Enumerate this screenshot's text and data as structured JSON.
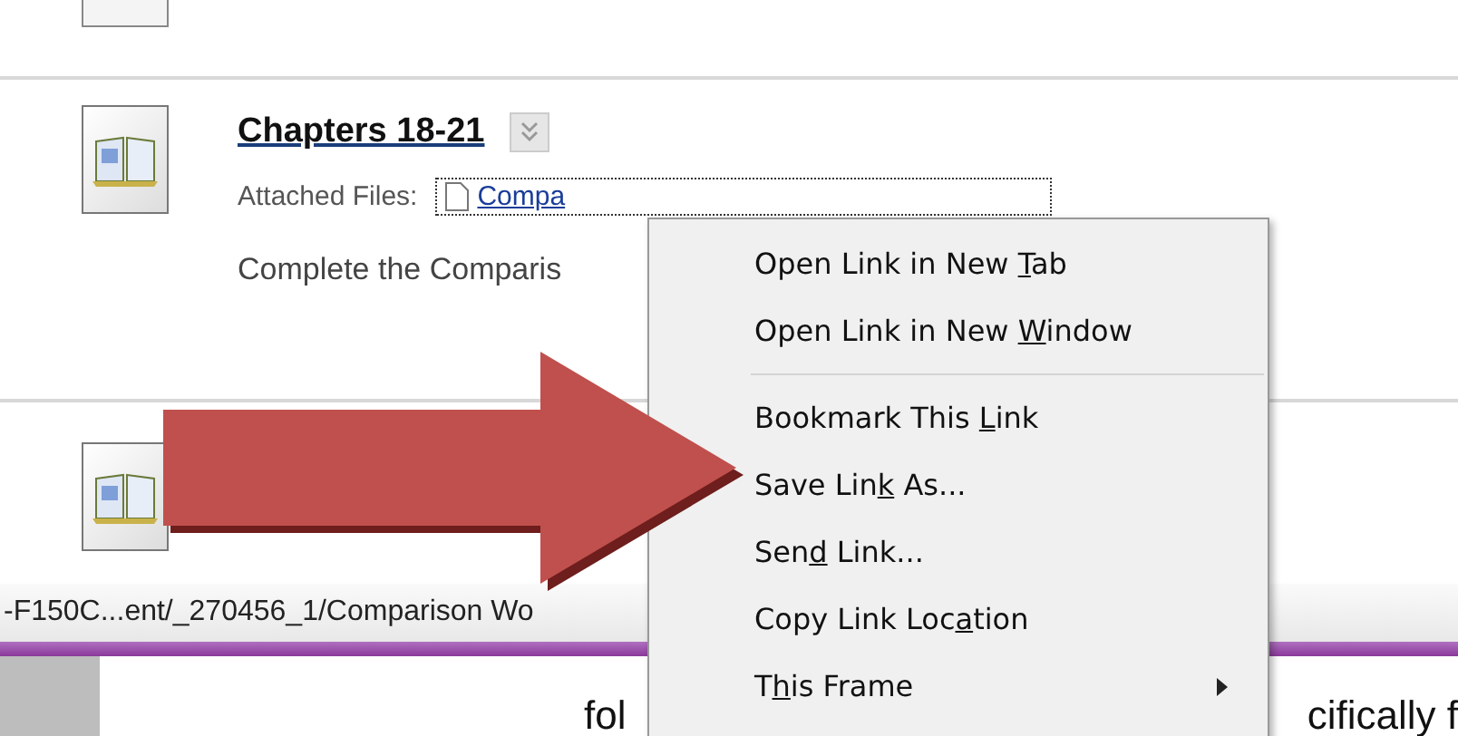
{
  "items": [
    {
      "title": "Chapters 18-21",
      "attached_label": "Attached Files:",
      "file_link": "Compa",
      "description": "Complete the Comparis"
    }
  ],
  "status_bar": {
    "url": "-F150C...ent/_270456_1/Comparison Wo"
  },
  "document": {
    "left_text": "fol",
    "right_text": "cifically f"
  },
  "context_menu": [
    {
      "kind": "item",
      "before": "Open Link in New ",
      "key": "T",
      "after": "ab"
    },
    {
      "kind": "item",
      "before": "Open Link in New ",
      "key": "W",
      "after": "indow"
    },
    {
      "kind": "separator"
    },
    {
      "kind": "item",
      "before": "Bookmark This ",
      "key": "L",
      "after": "ink"
    },
    {
      "kind": "item",
      "before": "Save Lin",
      "key": "k",
      "after": " As..."
    },
    {
      "kind": "item",
      "before": "Sen",
      "key": "d",
      "after": " Link..."
    },
    {
      "kind": "item",
      "before": "Copy Link Loc",
      "key": "a",
      "after": "tion"
    },
    {
      "kind": "submenu",
      "before": "T",
      "key": "h",
      "after": "is Frame"
    }
  ]
}
